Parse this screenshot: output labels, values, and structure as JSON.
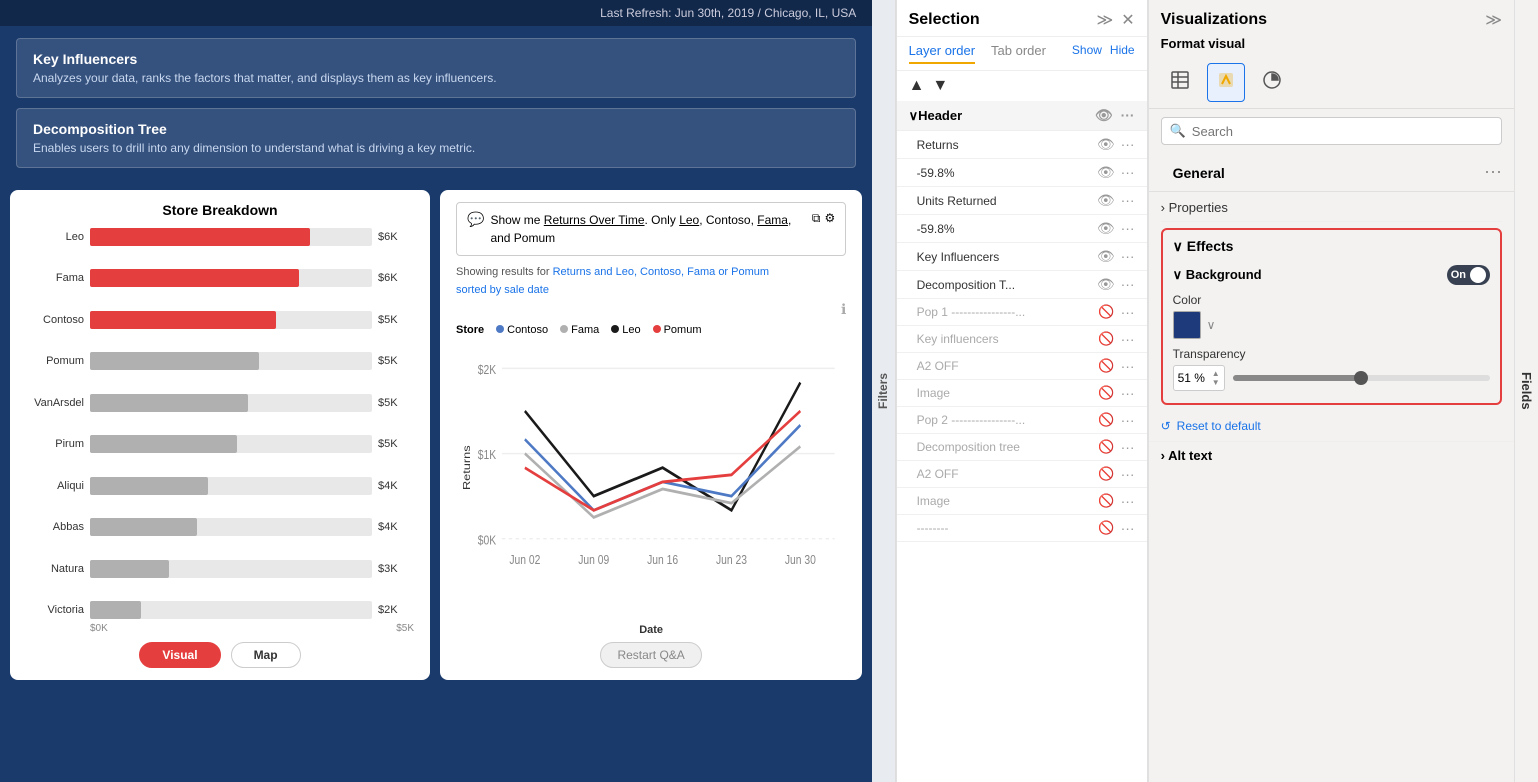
{
  "topbar": {
    "refresh_text": "Last Refresh: Jun 30th, 2019 / Chicago, IL, USA"
  },
  "cards": [
    {
      "title": "Key Influencers",
      "description": "Analyzes your data, ranks the factors that matter, and displays them as key influencers."
    },
    {
      "title": "Decomposition Tree",
      "description": "Enables users to drill into any dimension to understand what is driving a key metric."
    }
  ],
  "bar_chart": {
    "title": "Store Breakdown",
    "bars": [
      {
        "label": "Leo",
        "value": "$6K",
        "pct": 78
      },
      {
        "label": "Fama",
        "value": "$6K",
        "pct": 74
      },
      {
        "label": "Contoso",
        "value": "$5K",
        "pct": 66
      },
      {
        "label": "Pomum",
        "value": "$5K",
        "pct": 60
      },
      {
        "label": "VanArsdel",
        "value": "$5K",
        "pct": 56
      },
      {
        "label": "Pirum",
        "value": "$5K",
        "pct": 52
      },
      {
        "label": "Aliqui",
        "value": "$4K",
        "pct": 42
      },
      {
        "label": "Abbas",
        "value": "$4K",
        "pct": 38
      },
      {
        "label": "Natura",
        "value": "$3K",
        "pct": 28
      },
      {
        "label": "Victoria",
        "value": "$2K",
        "pct": 18
      }
    ],
    "axis_labels": [
      "$0K",
      "$5K"
    ],
    "tabs": [
      "Visual",
      "Map"
    ]
  },
  "line_chart": {
    "qa_text": "Show me Returns Over Time. Only Leo, Contoso, Fama, and Pomum",
    "showing_label": "Showing results for",
    "showing_link": "Returns and Leo, Contoso, Fama or Pomum",
    "sorted_label": "sorted by sale date",
    "store_label": "Store",
    "legend": [
      {
        "label": "Contoso",
        "color": "#4e79c4"
      },
      {
        "label": "Fama",
        "color": "#b0b0b0"
      },
      {
        "label": "Leo",
        "color": "#1a1a1a"
      },
      {
        "label": "Pomum",
        "color": "#e53e3e"
      }
    ],
    "y_label": "Returns",
    "x_label": "Date",
    "x_ticks": [
      "Jun 02",
      "Jun 09",
      "Jun 16",
      "Jun 23",
      "Jun 30"
    ],
    "y_ticks": [
      "$2K",
      "$1K",
      "$0K"
    ],
    "restart_label": "Restart Q&A"
  },
  "selection": {
    "title": "Selection",
    "tabs": [
      "Layer order",
      "Tab order"
    ],
    "show_label": "Show",
    "hide_label": "Hide",
    "group_header": "Header",
    "layers": [
      {
        "name": "Returns",
        "visible": true
      },
      {
        "name": "-59.8%",
        "visible": true
      },
      {
        "name": "Units Returned",
        "visible": true
      },
      {
        "name": "-59.8%",
        "visible": true
      },
      {
        "name": "Key Influencers",
        "visible": true
      },
      {
        "name": "Decomposition T...",
        "visible": true
      },
      {
        "name": "Pop 1 ----------------...",
        "visible": false
      },
      {
        "name": "Key influencers",
        "visible": false
      },
      {
        "name": "A2 OFF",
        "visible": false
      },
      {
        "name": "Image",
        "visible": false
      },
      {
        "name": "Pop 2 ----------------...",
        "visible": false
      },
      {
        "name": "Decomposition tree",
        "visible": false
      },
      {
        "name": "A2 OFF",
        "visible": false
      },
      {
        "name": "Image",
        "visible": false
      }
    ],
    "filters_label": "Filters"
  },
  "visualizations": {
    "title": "Visualizations",
    "format_label": "Format visual",
    "search_placeholder": "Search",
    "general_label": "General",
    "properties_label": "Properties",
    "effects_label": "Effects",
    "background_label": "Background",
    "toggle_label": "On",
    "color_label": "Color",
    "transparency_label": "Transparency",
    "transparency_value": "51 %",
    "reset_label": "Reset to default",
    "alt_text_label": "Alt text",
    "fields_label": "Fields"
  }
}
